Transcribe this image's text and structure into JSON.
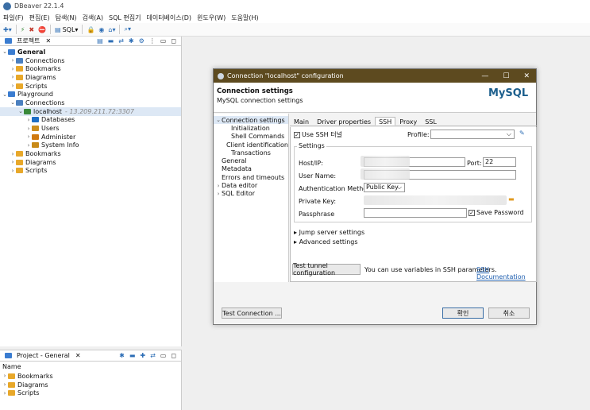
{
  "app_title": "DBeaver 22.1.4",
  "menu": [
    "파일(F)",
    "편집(E)",
    "탐색(N)",
    "검색(A)",
    "SQL 편집기",
    "데이터베이스(D)",
    "윈도우(W)",
    "도움말(H)"
  ],
  "toolbar": {
    "sql_label": "SQL"
  },
  "project_tab": "프로젝트",
  "tree": [
    {
      "label": "General",
      "indent": 0,
      "arrow": "⌄",
      "icon": "proj",
      "bold": true
    },
    {
      "label": "Connections",
      "indent": 1,
      "arrow": "›",
      "icon": "conn"
    },
    {
      "label": "Bookmarks",
      "indent": 1,
      "arrow": "›",
      "icon": "folder"
    },
    {
      "label": "Diagrams",
      "indent": 1,
      "arrow": "›",
      "icon": "folder"
    },
    {
      "label": "Scripts",
      "indent": 1,
      "arrow": "›",
      "icon": "folder"
    },
    {
      "label": "Playground",
      "indent": 0,
      "arrow": "⌄",
      "icon": "proj"
    },
    {
      "label": "Connections",
      "indent": 1,
      "arrow": "⌄",
      "icon": "conn"
    },
    {
      "label": "localhost",
      "indent": 2,
      "arrow": "⌄",
      "icon": "srv",
      "extra": "- 13.209.211.72:3307",
      "selected": true
    },
    {
      "label": "Databases",
      "indent": 3,
      "arrow": "›",
      "icon": "db"
    },
    {
      "label": "Users",
      "indent": 3,
      "arrow": "›",
      "icon": "users"
    },
    {
      "label": "Administer",
      "indent": 3,
      "arrow": "›",
      "icon": "adm"
    },
    {
      "label": "System Info",
      "indent": 3,
      "arrow": "›",
      "icon": "sys"
    },
    {
      "label": "Bookmarks",
      "indent": 1,
      "arrow": "›",
      "icon": "folder"
    },
    {
      "label": "Diagrams",
      "indent": 1,
      "arrow": "›",
      "icon": "folder"
    },
    {
      "label": "Scripts",
      "indent": 1,
      "arrow": "›",
      "icon": "folder"
    }
  ],
  "bottom_panel": {
    "tab": "Project - General",
    "header": "Name",
    "items": [
      "Bookmarks",
      "Diagrams",
      "Scripts"
    ]
  },
  "dialog": {
    "title": "Connection \"localhost\" configuration",
    "header_title": "Connection settings",
    "header_subtitle": "MySQL connection settings",
    "logo_text": "MySQL",
    "nav": [
      {
        "label": "Connection settings",
        "indent": 0,
        "arrow": "⌄",
        "selected": true
      },
      {
        "label": "Initialization",
        "indent": 1
      },
      {
        "label": "Shell Commands",
        "indent": 1
      },
      {
        "label": "Client identification",
        "indent": 1
      },
      {
        "label": "Transactions",
        "indent": 1
      },
      {
        "label": "General",
        "indent": 0
      },
      {
        "label": "Metadata",
        "indent": 0
      },
      {
        "label": "Errors and timeouts",
        "indent": 0
      },
      {
        "label": "Data editor",
        "indent": 0,
        "arrow": "›"
      },
      {
        "label": "SQL Editor",
        "indent": 0,
        "arrow": "›"
      }
    ],
    "tabs": [
      "Main",
      "Driver properties",
      "SSH",
      "Proxy",
      "SSL"
    ],
    "active_tab": "SSH",
    "ssh": {
      "use_ssh": "Use SSH 터널",
      "profile_label": "Profile:",
      "settings_label": "Settings",
      "host_label": "Host/IP:",
      "port_label": "Port:",
      "port_value": "22",
      "user_label": "User Name:",
      "auth_label": "Authentication Method:",
      "auth_value": "Public Key",
      "key_label": "Private Key:",
      "pass_label": "Passphrase",
      "save_password": "Save Password",
      "jump": "Jump server settings",
      "advanced": "Advanced settings",
      "test_tunnel": "Test tunnel configuration",
      "hint": "You can use variables in SSH parameters.",
      "doc_link": "SSH Documentation"
    },
    "test_connection": "Test Connection ...",
    "ok": "확인",
    "cancel": "취소"
  }
}
